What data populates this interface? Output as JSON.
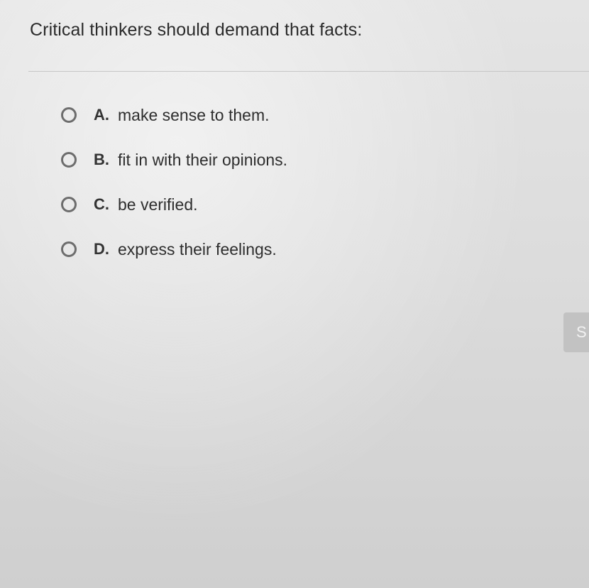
{
  "question": {
    "text": "Critical thinkers should demand that facts:"
  },
  "options": [
    {
      "letter": "A.",
      "text": "make sense to them.",
      "selected": false
    },
    {
      "letter": "B.",
      "text": "fit in with their opinions.",
      "selected": false
    },
    {
      "letter": "C.",
      "text": "be verified.",
      "selected": false
    },
    {
      "letter": "D.",
      "text": "express their feelings.",
      "selected": false
    }
  ],
  "side_button": {
    "label": "S"
  }
}
